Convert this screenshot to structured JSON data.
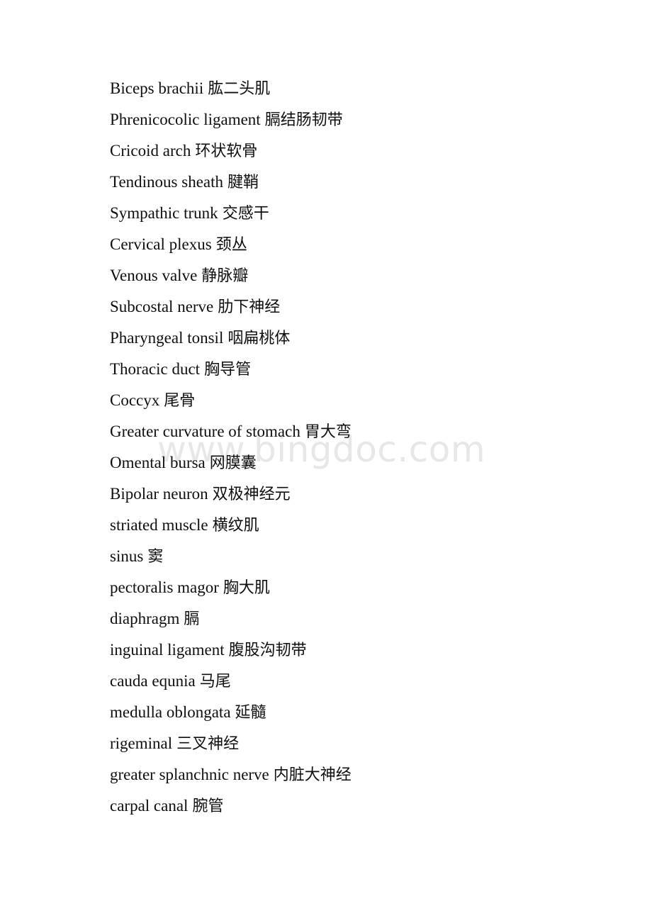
{
  "document": {
    "background_color": "#ffffff",
    "text_color": "#100f0f",
    "watermark": {
      "text": "www.bingdoc.com",
      "color": "#e7e7e7"
    },
    "entries": [
      {
        "term": "Biceps brachii",
        "gloss": "肱二头肌"
      },
      {
        "term": "Phrenicocolic ligament",
        "gloss": "膈结肠韧带"
      },
      {
        "term": "Cricoid arch",
        "gloss": "环状软骨"
      },
      {
        "term": "Tendinous sheath",
        "gloss": "腱鞘"
      },
      {
        "term": "Sympathic trunk",
        "gloss": "交感干"
      },
      {
        "term": "Cervical plexus",
        "gloss": "颈丛"
      },
      {
        "term": "Venous valve",
        "gloss": "静脉瓣"
      },
      {
        "term": "Subcostal nerve",
        "gloss": "肋下神经"
      },
      {
        "term": "Pharyngeal tonsil",
        "gloss": "咽扁桃体"
      },
      {
        "term": "Thoracic duct",
        "gloss": "胸导管"
      },
      {
        "term": "Coccyx",
        "gloss": "尾骨"
      },
      {
        "term": "Greater curvature of stomach",
        "gloss": "胃大弯"
      },
      {
        "term": "Omental bursa",
        "gloss": "网膜囊"
      },
      {
        "term": "Bipolar neuron",
        "gloss": "双极神经元"
      },
      {
        "term": "striated muscle",
        "gloss": "横纹肌"
      },
      {
        "term": "sinus",
        "gloss": "窦"
      },
      {
        "term": "pectoralis magor",
        "gloss": "胸大肌"
      },
      {
        "term": "diaphragm",
        "gloss": "膈"
      },
      {
        "term": "inguinal ligament",
        "gloss": "腹股沟韧带"
      },
      {
        "term": "cauda equnia",
        "gloss": "马尾"
      },
      {
        "term": "medulla oblongata",
        "gloss": "延髓"
      },
      {
        "term": "rigeminal",
        "gloss": "三叉神经"
      },
      {
        "term": "greater splanchnic nerve",
        "gloss": "内脏大神经"
      },
      {
        "term": "carpal canal",
        "gloss": "腕管"
      }
    ]
  }
}
